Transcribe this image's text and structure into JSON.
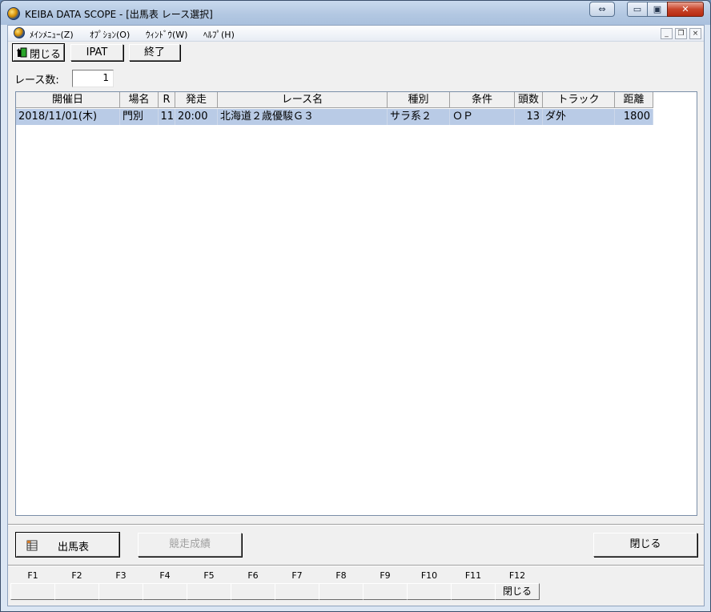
{
  "window": {
    "title": "KEIBA DATA SCOPE - [出馬表 レース選択]",
    "controls": {
      "special": "⇔",
      "minimize": "▭",
      "maximize": "▣",
      "close": "✕"
    }
  },
  "menubar": {
    "items": [
      {
        "label": "ﾒｲﾝﾒﾆｭｰ(Z)"
      },
      {
        "label": "ｵﾌﾟｼｮﾝ(O)"
      },
      {
        "label": "ｳｨﾝﾄﾞｳ(W)"
      },
      {
        "label": "ﾍﾙﾌﾟ(H)"
      }
    ],
    "mdi": {
      "minimize": "_",
      "restore": "❐",
      "close": "×"
    }
  },
  "toolbar": {
    "close_label": "閉じる",
    "ipat_label": "IPAT",
    "exit_label": "終了"
  },
  "race_count": {
    "label": "レース数:",
    "value": "1"
  },
  "table": {
    "columns": [
      "開催日",
      "場名",
      "R",
      "発走",
      "レース名",
      "種別",
      "条件",
      "頭数",
      "トラック",
      "距離"
    ],
    "rows": [
      {
        "date": "2018/11/01(木)",
        "venue": "門別",
        "race_no": "11",
        "start": "20:00",
        "name": "北海道２歳優駿Ｇ３",
        "type": "サラ系２",
        "condition": "ＯＰ",
        "runners": "13",
        "track": "ダ外",
        "distance": "1800"
      }
    ]
  },
  "bottom": {
    "shutsuba_label": "出馬表",
    "results_label": "競走成績",
    "close_label": "閉じる"
  },
  "fkeys": {
    "labels": [
      "F1",
      "F2",
      "F3",
      "F4",
      "F5",
      "F6",
      "F7",
      "F8",
      "F9",
      "F10",
      "F11",
      "F12"
    ],
    "f12_action": "閉じる"
  },
  "colors": {
    "selected_row": "#b9cbe6",
    "titlebar": "#b3c8e2",
    "close_button": "#c8452b"
  }
}
